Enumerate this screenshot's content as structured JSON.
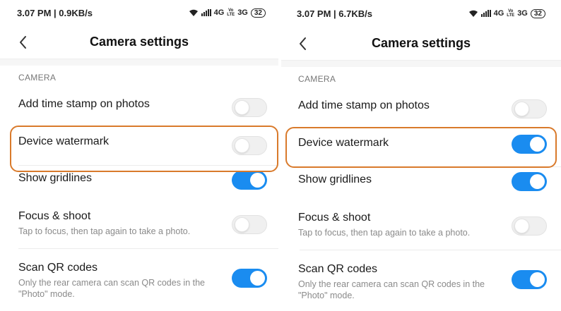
{
  "colors": {
    "accent": "#1a8cf0",
    "highlight": "#d97a2b"
  },
  "left": {
    "status": {
      "time": "3.07 PM",
      "speed": "0.9KB/s",
      "network_4g": "4G",
      "volte_top": "Vo",
      "volte_bottom": "LTE",
      "network_3g": "3G",
      "battery": "32"
    },
    "title": "Camera settings",
    "section": "CAMERA",
    "settings": [
      {
        "title": "Add time stamp on photos",
        "subtitle": "",
        "on": false
      },
      {
        "title": "Device watermark",
        "subtitle": "",
        "on": false
      },
      {
        "title": "Show gridlines",
        "subtitle": "",
        "on": true
      },
      {
        "title": "Focus & shoot",
        "subtitle": "Tap to focus, then tap again to take a photo.",
        "on": false
      },
      {
        "title": "Scan QR codes",
        "subtitle": "Only the rear camera can scan QR codes in the \"Photo\" mode.",
        "on": true
      }
    ]
  },
  "right": {
    "status": {
      "time": "3.07 PM",
      "speed": "6.7KB/s",
      "network_4g": "4G",
      "volte_top": "Vo",
      "volte_bottom": "LTE",
      "network_3g": "3G",
      "battery": "32"
    },
    "title": "Camera settings",
    "section": "CAMERA",
    "settings": [
      {
        "title": "Add time stamp on photos",
        "subtitle": "",
        "on": false
      },
      {
        "title": "Device watermark",
        "subtitle": "",
        "on": true
      },
      {
        "title": "Show gridlines",
        "subtitle": "",
        "on": true
      },
      {
        "title": "Focus & shoot",
        "subtitle": "Tap to focus, then tap again to take a photo.",
        "on": false
      },
      {
        "title": "Scan QR codes",
        "subtitle": "Only the rear camera can scan QR codes in the \"Photo\" mode.",
        "on": true
      }
    ]
  }
}
